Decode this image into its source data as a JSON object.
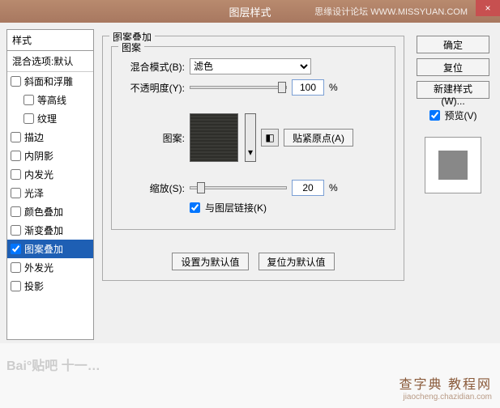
{
  "titlebar": {
    "title": "图层样式",
    "site": "思缘设计论坛  WWW.MISSYUAN.COM",
    "close": "×"
  },
  "left": {
    "header": "样式",
    "blend_default": "混合选项:默认",
    "items": [
      {
        "label": "斜面和浮雕",
        "checked": false,
        "indent": false
      },
      {
        "label": "等高线",
        "checked": false,
        "indent": true
      },
      {
        "label": "纹理",
        "checked": false,
        "indent": true
      },
      {
        "label": "描边",
        "checked": false,
        "indent": false
      },
      {
        "label": "内阴影",
        "checked": false,
        "indent": false
      },
      {
        "label": "内发光",
        "checked": false,
        "indent": false
      },
      {
        "label": "光泽",
        "checked": false,
        "indent": false
      },
      {
        "label": "颜色叠加",
        "checked": false,
        "indent": false
      },
      {
        "label": "渐变叠加",
        "checked": false,
        "indent": false
      },
      {
        "label": "图案叠加",
        "checked": true,
        "indent": false,
        "selected": true
      },
      {
        "label": "外发光",
        "checked": false,
        "indent": false
      },
      {
        "label": "投影",
        "checked": false,
        "indent": false
      }
    ]
  },
  "center": {
    "group_outer": "图案叠加",
    "group_inner": "图案",
    "blend_mode_label": "混合模式(B):",
    "blend_mode_value": "滤色",
    "opacity_label": "不透明度(Y):",
    "opacity_value": "100",
    "opacity_unit": "%",
    "pattern_label": "图案:",
    "snap_btn": "贴紧原点(A)",
    "scale_label": "缩放(S):",
    "scale_value": "20",
    "scale_unit": "%",
    "link_label": "与图层链接(K)",
    "set_default": "设置为默认值",
    "reset_default": "复位为默认值"
  },
  "right": {
    "ok": "确定",
    "cancel": "复位",
    "new_style": "新建样式(W)...",
    "preview": "预览(V)"
  },
  "footer": {
    "wm_bl": "Bai°贴吧 十一…",
    "wm_br1": "查字典 教程网",
    "wm_br2": "jiaocheng.chazidian.com"
  }
}
